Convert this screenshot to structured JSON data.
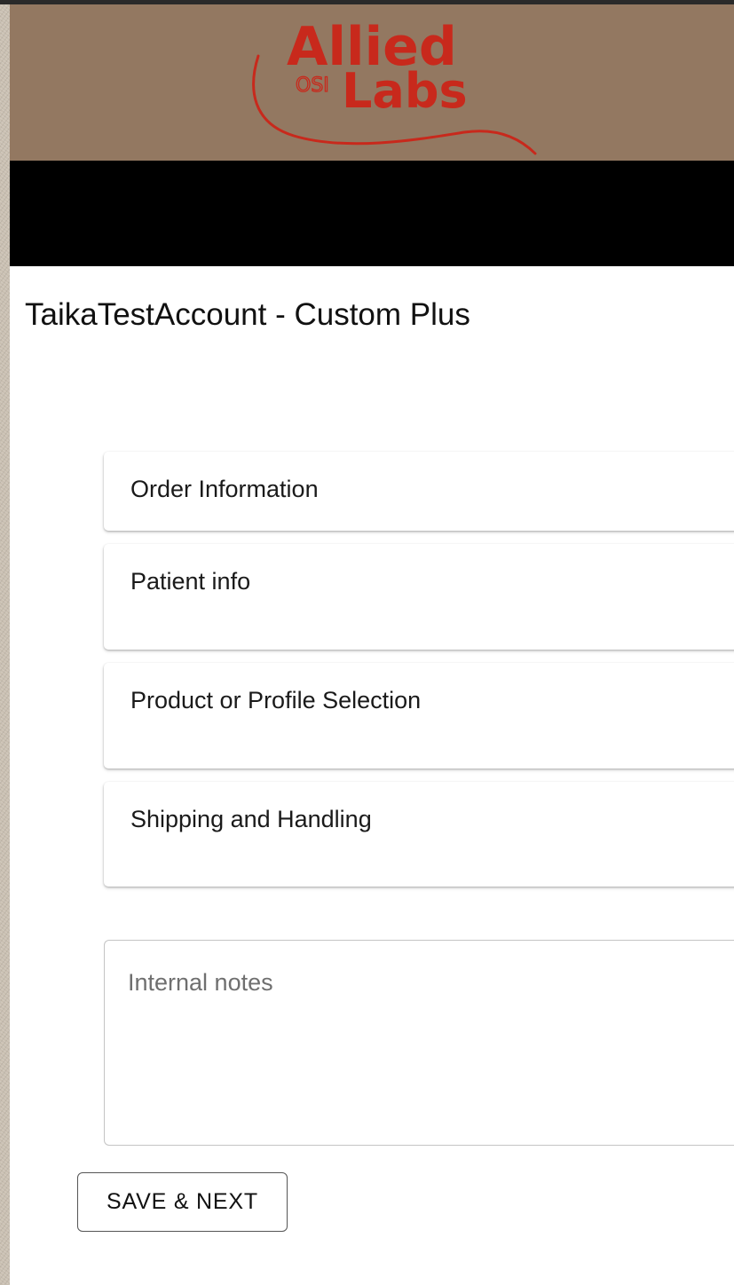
{
  "header": {
    "logo": {
      "line1": "Allied",
      "line2": "Labs",
      "tag": "OSI",
      "color": "#c8291c"
    },
    "banner_color": "#937861"
  },
  "account_title": "TaikaTestAccount - Custom Plus",
  "sections": [
    {
      "label": "Order Information"
    },
    {
      "label": "Patient info"
    },
    {
      "label": "Product or Profile Selection"
    },
    {
      "label": "Shipping and Handling"
    }
  ],
  "internal_notes": {
    "placeholder": "Internal notes",
    "value": ""
  },
  "buttons": {
    "save_next": "SAVE & NEXT"
  }
}
